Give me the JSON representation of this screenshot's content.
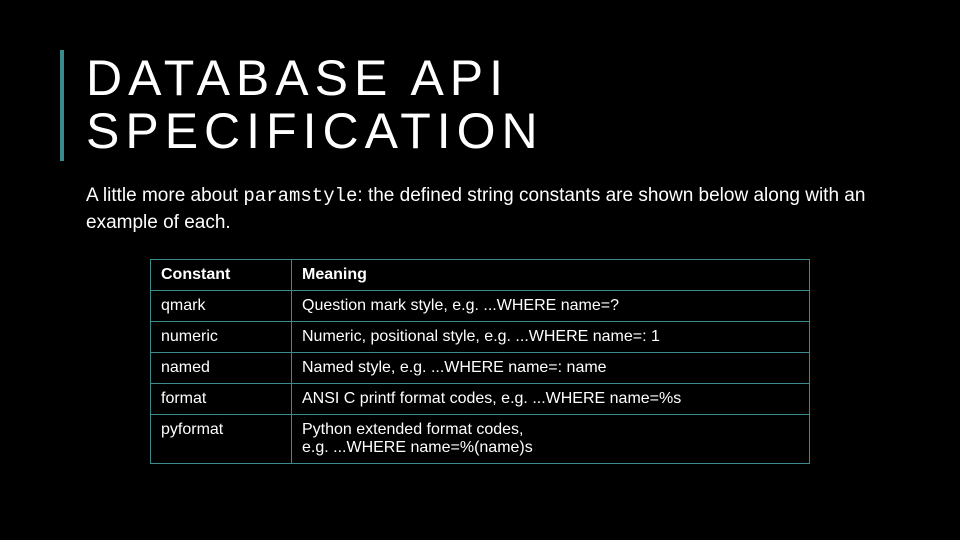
{
  "title_line1": "DATABASE API",
  "title_line2": "SPECIFICATION",
  "desc_prefix": "A little more about ",
  "desc_code": "paramstyle",
  "desc_suffix": ": the defined string constants are shown below along with an example of each.",
  "headers": {
    "constant": "Constant",
    "meaning": "Meaning"
  },
  "rows": [
    {
      "constant": "qmark",
      "meaning": "Question mark style, e.g. ...WHERE name=?"
    },
    {
      "constant": "numeric",
      "meaning": "Numeric, positional style, e.g. ...WHERE name=: 1"
    },
    {
      "constant": "named",
      "meaning": "Named style, e.g. ...WHERE name=: name"
    },
    {
      "constant": "format",
      "meaning": "ANSI C printf format codes, e.g. ...WHERE name=%s"
    },
    {
      "constant": "pyformat",
      "meaning": "Python extended format codes,\ne.g. ...WHERE name=%(name)s"
    }
  ]
}
